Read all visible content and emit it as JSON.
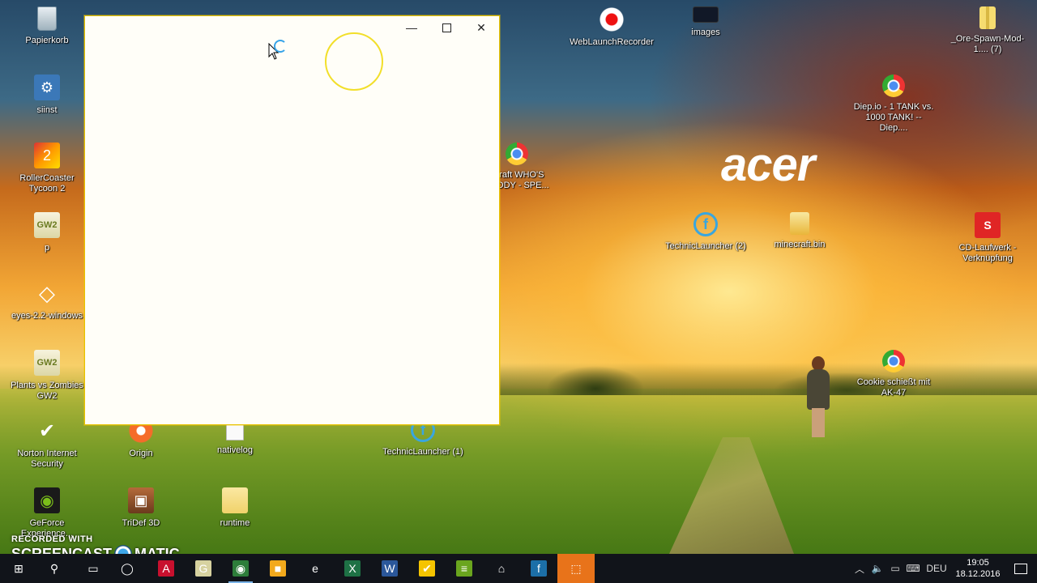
{
  "desktop": {
    "brand_logo": "acer",
    "icons": [
      {
        "id": "papierkorb",
        "label": "Papierkorb",
        "icon": "recycle-bin-icon",
        "style": "g-recycle",
        "glyph": ""
      },
      {
        "id": "siinst",
        "label": "siinst",
        "icon": "setup-icon",
        "style": "g-setup",
        "glyph": "⚙"
      },
      {
        "id": "rollercoaster",
        "label": "RollerCoaster Tycoon 2",
        "icon": "rollercoaster-tycoon-icon",
        "style": "g-rct",
        "glyph": "2"
      },
      {
        "id": "p",
        "label": "p",
        "icon": "gw2-shortcut-icon",
        "style": "g-gw2",
        "glyph": "GW2"
      },
      {
        "id": "eyes",
        "label": "eyes-2.2-windows",
        "icon": "unity-icon",
        "style": "g-unity",
        "glyph": "◇"
      },
      {
        "id": "pvz",
        "label": "Plants vs Zombies GW2",
        "icon": "gw2-shortcut-icon",
        "style": "g-gw2",
        "glyph": "GW2"
      },
      {
        "id": "norton",
        "label": "Norton Internet Security",
        "icon": "norton-check-icon",
        "style": "g-norton",
        "glyph": "✔"
      },
      {
        "id": "geforce",
        "label": "GeForce Experience...",
        "icon": "geforce-icon",
        "style": "g-geforce",
        "glyph": "◉"
      },
      {
        "id": "origin",
        "label": "Origin",
        "icon": "origin-icon",
        "style": "g-origin",
        "glyph": ""
      },
      {
        "id": "tridef",
        "label": "TriDef 3D",
        "icon": "tridef-icon",
        "style": "g-tridef",
        "glyph": "▣"
      },
      {
        "id": "nativelog",
        "label": "nativelog",
        "icon": "text-document-icon",
        "style": "g-doc",
        "glyph": ""
      },
      {
        "id": "runtime",
        "label": "runtime",
        "icon": "folder-icon",
        "style": "g-folder",
        "glyph": ""
      },
      {
        "id": "technic1",
        "label": "TechnicLauncher (1)",
        "icon": "technic-launcher-icon",
        "style": "g-technic",
        "glyph": "f"
      },
      {
        "id": "webrec",
        "label": "WebLaunchRecorder",
        "icon": "record-icon",
        "style": "g-record",
        "glyph": ""
      },
      {
        "id": "images",
        "label": "images",
        "icon": "image-folder-icon",
        "style": "g-images",
        "glyph": ""
      },
      {
        "id": "orespawn",
        "label": "_Ore-Spawn-Mod-1.... (7)",
        "icon": "zip-folder-icon",
        "style": "g-zip",
        "glyph": ""
      },
      {
        "id": "diep",
        "label": "Diep.io - 1 TANK vs. 1000 TANK! -- Diep....",
        "icon": "chrome-shortcut-icon",
        "style": "g-chrome",
        "glyph": ""
      },
      {
        "id": "minecraftwho",
        "label": "ecraft WHO'S DADDY - SPE...",
        "icon": "chrome-shortcut-icon",
        "style": "g-chrome",
        "glyph": ""
      },
      {
        "id": "technic2",
        "label": "TechnicLauncher (2)",
        "icon": "technic-launcher-icon",
        "style": "g-technic",
        "glyph": "f"
      },
      {
        "id": "mcbin",
        "label": "minecraft.bin",
        "icon": "minecraft-bin-icon",
        "style": "g-mc",
        "glyph": ""
      },
      {
        "id": "cd",
        "label": "CD-Laufwerk - Verknüpfung",
        "icon": "cd-drive-icon",
        "style": "g-cd",
        "glyph": "S"
      },
      {
        "id": "cookie",
        "label": "Cookie schießt mit AK-47",
        "icon": "chrome-shortcut-icon",
        "style": "g-chrome",
        "glyph": ""
      }
    ]
  },
  "window": {
    "minimize_glyph": "—",
    "close_glyph": "✕"
  },
  "watermark": {
    "top": "RECORDED WITH",
    "left": "SCREENCAST",
    "right": "MATIC"
  },
  "taskbar": {
    "items": [
      {
        "id": "start",
        "icon": "windows-start-icon",
        "glyph": "⊞",
        "bg": "transparent",
        "active": false
      },
      {
        "id": "search",
        "icon": "search-icon",
        "glyph": "⚲",
        "bg": "transparent",
        "active": false
      },
      {
        "id": "taskview",
        "icon": "task-view-icon",
        "glyph": "▭",
        "bg": "transparent",
        "active": false
      },
      {
        "id": "cortana",
        "icon": "cortana-icon",
        "glyph": "◯",
        "bg": "transparent",
        "active": false
      },
      {
        "id": "acrobat",
        "icon": "acrobat-icon",
        "glyph": "A",
        "bg": "#c8102e",
        "active": false
      },
      {
        "id": "gw2",
        "icon": "gw2-icon",
        "glyph": "G",
        "bg": "#d7d2a0",
        "active": false
      },
      {
        "id": "chrome",
        "icon": "chrome-icon",
        "glyph": "◉",
        "bg": "#2d7d3a",
        "active": true
      },
      {
        "id": "notes",
        "icon": "notes-icon",
        "glyph": "■",
        "bg": "#f2a91c",
        "active": false
      },
      {
        "id": "edge",
        "icon": "edge-icon",
        "glyph": "e",
        "bg": "transparent",
        "active": false
      },
      {
        "id": "excel",
        "icon": "excel-icon",
        "glyph": "X",
        "bg": "#1e7145",
        "active": false
      },
      {
        "id": "word",
        "icon": "word-icon",
        "glyph": "W",
        "bg": "#2b579a",
        "active": false
      },
      {
        "id": "norton",
        "icon": "norton-icon",
        "glyph": "✔",
        "bg": "#f5c400",
        "active": false
      },
      {
        "id": "bluestacks",
        "icon": "bluestacks-icon",
        "glyph": "≡",
        "bg": "#6aa51e",
        "active": false
      },
      {
        "id": "home",
        "icon": "home-icon",
        "glyph": "⌂",
        "bg": "transparent",
        "active": false
      },
      {
        "id": "technic",
        "icon": "technic-launcher-icon",
        "glyph": "f",
        "bg": "#1c6fa8",
        "active": false
      },
      {
        "id": "recorder",
        "icon": "screen-recorder-icon",
        "glyph": "⬚",
        "bg": "transparent",
        "active": false,
        "highlight": true
      }
    ],
    "tray": {
      "language": "DEU",
      "time": "19:05",
      "date": "18.12.2016"
    }
  },
  "colors": {
    "taskbar_bg": "#11141a",
    "taskbar_highlight": "#e8731a",
    "window_border": "#e8c200",
    "cursor_ring": "#f2df2a"
  }
}
